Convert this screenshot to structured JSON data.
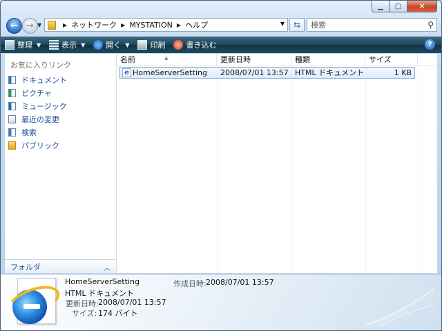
{
  "address": {
    "crumbs": [
      "ネットワーク",
      "MYSTATION",
      "ヘルプ"
    ]
  },
  "search": {
    "placeholder": "検索"
  },
  "toolbar": {
    "organize": "整理",
    "view": "表示",
    "open": "開く",
    "print": "印刷",
    "burn": "書き込む"
  },
  "sidebar": {
    "header": "お気に入りリンク",
    "items": [
      "ドキュメント",
      "ピクチャ",
      "ミュージック",
      "最近の変更",
      "検索",
      "パブリック"
    ],
    "folders_label": "フォルダ"
  },
  "columns": {
    "name": "名前",
    "modified": "更新日時",
    "type": "種類",
    "size": "サイズ"
  },
  "files": [
    {
      "name": "HomeServerSetting",
      "modified": "2008/07/01 13:57",
      "type": "HTML ドキュメント",
      "size": "1 KB"
    }
  ],
  "details": {
    "name": "HomeServerSetting",
    "type": "HTML ドキュメント",
    "modified_label": "更新日時:",
    "modified": "2008/07/01 13:57",
    "size_label": "サイズ:",
    "size": "174 バイト",
    "created_label": "作成日時:",
    "created": "2008/07/01 13:57"
  },
  "colors": {
    "toolbar_dark": "#1d4457",
    "link_blue": "#1d4fa0",
    "selection_border": "#7fa8cf"
  }
}
